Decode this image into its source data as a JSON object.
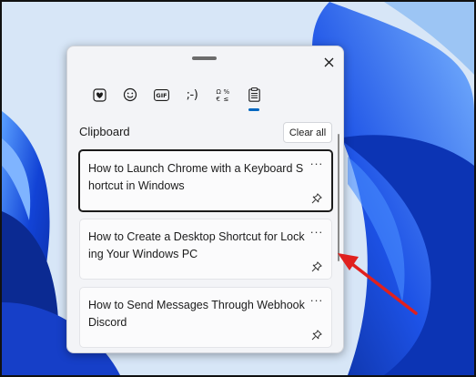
{
  "tabs": [
    {
      "name": "tab-stickers",
      "icon": "heart-sticker-icon"
    },
    {
      "name": "tab-emoji",
      "icon": "smiley-icon"
    },
    {
      "name": "tab-gif",
      "icon": "gif-icon",
      "label": "GIF"
    },
    {
      "name": "tab-kaomoji",
      "icon": "kaomoji-icon",
      "label": ";-)"
    },
    {
      "name": "tab-symbols",
      "icon": "symbols-icon"
    },
    {
      "name": "tab-clipboard",
      "icon": "clipboard-icon"
    }
  ],
  "clipboard": {
    "title": "Clipboard",
    "clear_all": "Clear all",
    "items": [
      {
        "text": "How to Launch Chrome with a Keyboard Shortcut in Windows",
        "more": "···"
      },
      {
        "text": "How to Create a Desktop Shortcut for Locking Your Windows PC",
        "more": "···"
      },
      {
        "text": "How to Send Messages Through Webhook Discord",
        "more": "···"
      }
    ]
  },
  "colors": {
    "accent": "#0067c0",
    "arrow": "#e0201e",
    "wallpaper": "#1a4fd8"
  }
}
